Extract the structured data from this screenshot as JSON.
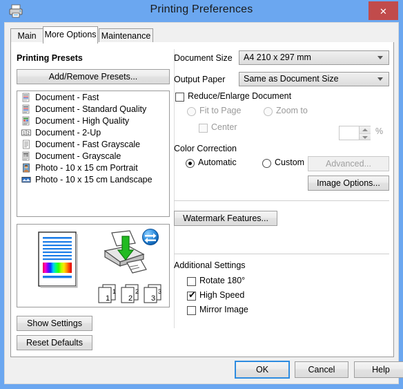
{
  "window": {
    "title": "Printing Preferences",
    "printer_icon": "printer-icon",
    "close_label": "✕",
    "titlebar_color": "#6ba7f0",
    "close_color": "#c14b4b"
  },
  "tabs": [
    {
      "label": "Main",
      "active": false
    },
    {
      "label": "More Options",
      "active": true
    },
    {
      "label": "Maintenance",
      "active": false
    }
  ],
  "left_panel": {
    "presets_title": "Printing Presets",
    "add_remove_label": "Add/Remove Presets...",
    "presets": [
      {
        "label": "Document - Fast",
        "icon": "document-fast-icon"
      },
      {
        "label": "Document - Standard Quality",
        "icon": "document-standard-icon"
      },
      {
        "label": "Document - High Quality",
        "icon": "document-high-quality-icon"
      },
      {
        "label": "Document - 2-Up",
        "icon": "document-2up-icon"
      },
      {
        "label": "Document - Fast Grayscale",
        "icon": "document-fast-grayscale-icon"
      },
      {
        "label": "Document - Grayscale",
        "icon": "document-grayscale-icon"
      },
      {
        "label": "Photo - 10 x 15 cm Portrait",
        "icon": "photo-portrait-icon"
      },
      {
        "label": "Photo - 10 x 15 cm Landscape",
        "icon": "photo-landscape-icon"
      }
    ],
    "preview": {
      "page_numbers": [
        "1",
        "2",
        "3"
      ],
      "globe_icon": "bidirectional-arrows-globe-icon",
      "printer_icon": "printer-feed-icon",
      "document_icon": "color-document-preview-icon"
    },
    "show_settings_label": "Show Settings",
    "reset_defaults_label": "Reset Defaults"
  },
  "right_panel": {
    "document_size_label": "Document Size",
    "document_size_value": "A4 210 x 297 mm",
    "output_paper_label": "Output Paper",
    "output_paper_value": "Same as Document Size",
    "reduce_enlarge_label": "Reduce/Enlarge Document",
    "reduce_enlarge_checked": false,
    "fit_to_page_label": "Fit to Page",
    "fit_to_page_selected": false,
    "zoom_to_label": "Zoom to",
    "zoom_to_selected": false,
    "zoom_value": "",
    "percent_label": "%",
    "center_label": "Center",
    "center_checked": false,
    "color_correction_label": "Color Correction",
    "automatic_label": "Automatic",
    "automatic_selected": true,
    "custom_label": "Custom",
    "custom_selected": false,
    "advanced_label": "Advanced...",
    "advanced_enabled": false,
    "image_options_label": "Image Options...",
    "watermark_label": "Watermark Features...",
    "additional_settings_label": "Additional Settings",
    "rotate_label": "Rotate 180°",
    "rotate_checked": false,
    "high_speed_label": "High Speed",
    "high_speed_checked": true,
    "mirror_label": "Mirror Image",
    "mirror_checked": false
  },
  "footer": {
    "ok_label": "OK",
    "cancel_label": "Cancel",
    "help_label": "Help"
  }
}
